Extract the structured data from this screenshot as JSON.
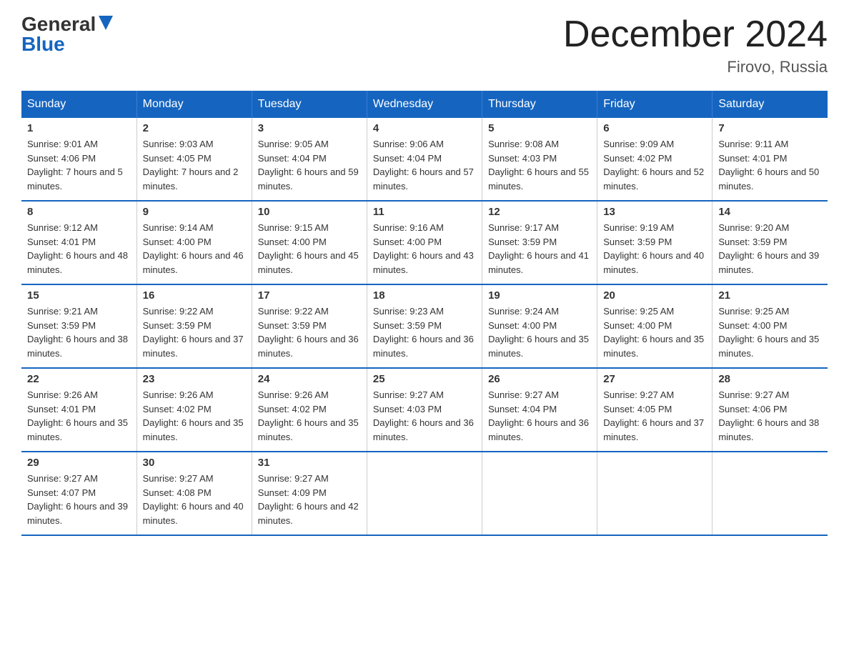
{
  "header": {
    "logo_general": "General",
    "logo_blue": "Blue",
    "title": "December 2024",
    "subtitle": "Firovo, Russia"
  },
  "weekdays": [
    "Sunday",
    "Monday",
    "Tuesday",
    "Wednesday",
    "Thursday",
    "Friday",
    "Saturday"
  ],
  "weeks": [
    [
      {
        "day": "1",
        "sunrise": "9:01 AM",
        "sunset": "4:06 PM",
        "daylight": "7 hours and 5 minutes."
      },
      {
        "day": "2",
        "sunrise": "9:03 AM",
        "sunset": "4:05 PM",
        "daylight": "7 hours and 2 minutes."
      },
      {
        "day": "3",
        "sunrise": "9:05 AM",
        "sunset": "4:04 PM",
        "daylight": "6 hours and 59 minutes."
      },
      {
        "day": "4",
        "sunrise": "9:06 AM",
        "sunset": "4:04 PM",
        "daylight": "6 hours and 57 minutes."
      },
      {
        "day": "5",
        "sunrise": "9:08 AM",
        "sunset": "4:03 PM",
        "daylight": "6 hours and 55 minutes."
      },
      {
        "day": "6",
        "sunrise": "9:09 AM",
        "sunset": "4:02 PM",
        "daylight": "6 hours and 52 minutes."
      },
      {
        "day": "7",
        "sunrise": "9:11 AM",
        "sunset": "4:01 PM",
        "daylight": "6 hours and 50 minutes."
      }
    ],
    [
      {
        "day": "8",
        "sunrise": "9:12 AM",
        "sunset": "4:01 PM",
        "daylight": "6 hours and 48 minutes."
      },
      {
        "day": "9",
        "sunrise": "9:14 AM",
        "sunset": "4:00 PM",
        "daylight": "6 hours and 46 minutes."
      },
      {
        "day": "10",
        "sunrise": "9:15 AM",
        "sunset": "4:00 PM",
        "daylight": "6 hours and 45 minutes."
      },
      {
        "day": "11",
        "sunrise": "9:16 AM",
        "sunset": "4:00 PM",
        "daylight": "6 hours and 43 minutes."
      },
      {
        "day": "12",
        "sunrise": "9:17 AM",
        "sunset": "3:59 PM",
        "daylight": "6 hours and 41 minutes."
      },
      {
        "day": "13",
        "sunrise": "9:19 AM",
        "sunset": "3:59 PM",
        "daylight": "6 hours and 40 minutes."
      },
      {
        "day": "14",
        "sunrise": "9:20 AM",
        "sunset": "3:59 PM",
        "daylight": "6 hours and 39 minutes."
      }
    ],
    [
      {
        "day": "15",
        "sunrise": "9:21 AM",
        "sunset": "3:59 PM",
        "daylight": "6 hours and 38 minutes."
      },
      {
        "day": "16",
        "sunrise": "9:22 AM",
        "sunset": "3:59 PM",
        "daylight": "6 hours and 37 minutes."
      },
      {
        "day": "17",
        "sunrise": "9:22 AM",
        "sunset": "3:59 PM",
        "daylight": "6 hours and 36 minutes."
      },
      {
        "day": "18",
        "sunrise": "9:23 AM",
        "sunset": "3:59 PM",
        "daylight": "6 hours and 36 minutes."
      },
      {
        "day": "19",
        "sunrise": "9:24 AM",
        "sunset": "4:00 PM",
        "daylight": "6 hours and 35 minutes."
      },
      {
        "day": "20",
        "sunrise": "9:25 AM",
        "sunset": "4:00 PM",
        "daylight": "6 hours and 35 minutes."
      },
      {
        "day": "21",
        "sunrise": "9:25 AM",
        "sunset": "4:00 PM",
        "daylight": "6 hours and 35 minutes."
      }
    ],
    [
      {
        "day": "22",
        "sunrise": "9:26 AM",
        "sunset": "4:01 PM",
        "daylight": "6 hours and 35 minutes."
      },
      {
        "day": "23",
        "sunrise": "9:26 AM",
        "sunset": "4:02 PM",
        "daylight": "6 hours and 35 minutes."
      },
      {
        "day": "24",
        "sunrise": "9:26 AM",
        "sunset": "4:02 PM",
        "daylight": "6 hours and 35 minutes."
      },
      {
        "day": "25",
        "sunrise": "9:27 AM",
        "sunset": "4:03 PM",
        "daylight": "6 hours and 36 minutes."
      },
      {
        "day": "26",
        "sunrise": "9:27 AM",
        "sunset": "4:04 PM",
        "daylight": "6 hours and 36 minutes."
      },
      {
        "day": "27",
        "sunrise": "9:27 AM",
        "sunset": "4:05 PM",
        "daylight": "6 hours and 37 minutes."
      },
      {
        "day": "28",
        "sunrise": "9:27 AM",
        "sunset": "4:06 PM",
        "daylight": "6 hours and 38 minutes."
      }
    ],
    [
      {
        "day": "29",
        "sunrise": "9:27 AM",
        "sunset": "4:07 PM",
        "daylight": "6 hours and 39 minutes."
      },
      {
        "day": "30",
        "sunrise": "9:27 AM",
        "sunset": "4:08 PM",
        "daylight": "6 hours and 40 minutes."
      },
      {
        "day": "31",
        "sunrise": "9:27 AM",
        "sunset": "4:09 PM",
        "daylight": "6 hours and 42 minutes."
      },
      null,
      null,
      null,
      null
    ]
  ]
}
